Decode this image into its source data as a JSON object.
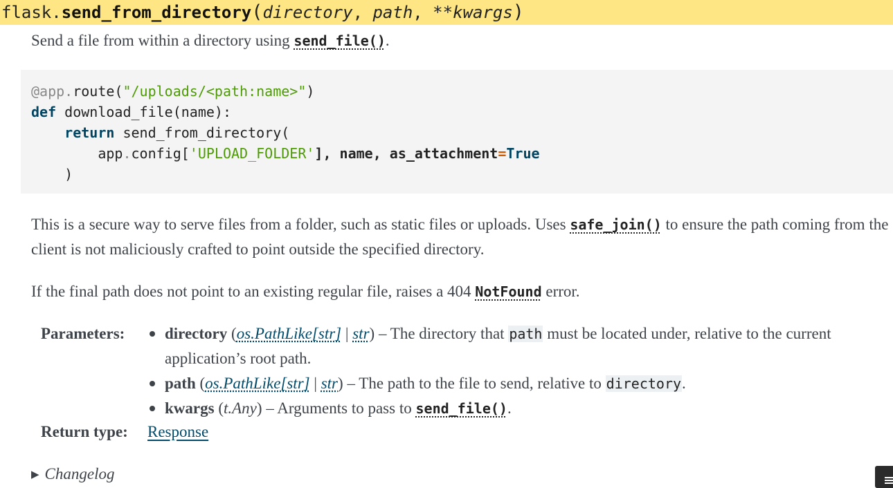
{
  "signature": {
    "prefix": "flask.",
    "name": "send_from_directory",
    "open": "(",
    "param1": "directory",
    "sep1": ", ",
    "param2": "path",
    "sep2": ", ",
    "param3": "**kwargs",
    "close": ")"
  },
  "intro": {
    "text_before": "Send a file from within a directory using ",
    "link": "send_file()",
    "text_after": "."
  },
  "code_lines": {
    "l1_deco": "@app",
    "l1_dot": ".",
    "l1_name": "route(",
    "l1_str": "\"/uploads/<path:name>\"",
    "l1_close": ")",
    "l2_kw": "def",
    "l2_rest": " download_file(name):",
    "l3_indent": "    ",
    "l3_kw": "return",
    "l3_rest": " send_from_directory(",
    "l4_indent": "        app",
    "l4_dot": ".",
    "l4_mid": "config[",
    "l4_str": "'UPLOAD_FOLDER'",
    "l4_after": "], name, as_attachment",
    "l4_eq": "=",
    "l4_true": "True",
    "l5": "    )"
  },
  "para2": {
    "text_before": "This is a secure way to serve files from a folder, such as static files or uploads. Uses ",
    "link": "safe_join()",
    "text_after": " to ensure the path coming from the client is not maliciously crafted to point outside the specified directory."
  },
  "para3": {
    "text_before": "If the final path does not point to an existing regular file, raises a 404 ",
    "link": "NotFound",
    "text_after": " error."
  },
  "params_label": "Parameters:",
  "params": [
    {
      "name": "directory",
      "open": " (",
      "type1": "os.PathLike[str]",
      "bar": " | ",
      "type2": "str",
      "close": ")",
      "desc_before": " – The directory that ",
      "literal": "path",
      "desc_after": " must be located under, relative to the current application’s root path."
    },
    {
      "name": "path",
      "open": " (",
      "type1": "os.PathLike[str]",
      "bar": " | ",
      "type2": "str",
      "close": ")",
      "desc_before": " – The path to the file to send, relative to ",
      "literal": "directory",
      "desc_after": "."
    },
    {
      "name": "kwargs",
      "open": " (",
      "type1": "t.Any",
      "close": ")",
      "desc_before": " – Arguments to pass to ",
      "link": "send_file()",
      "desc_after": "."
    }
  ],
  "return_label": "Return type:",
  "return_type": "Response",
  "changelog": {
    "marker": "▶",
    "label": "Changelog"
  }
}
